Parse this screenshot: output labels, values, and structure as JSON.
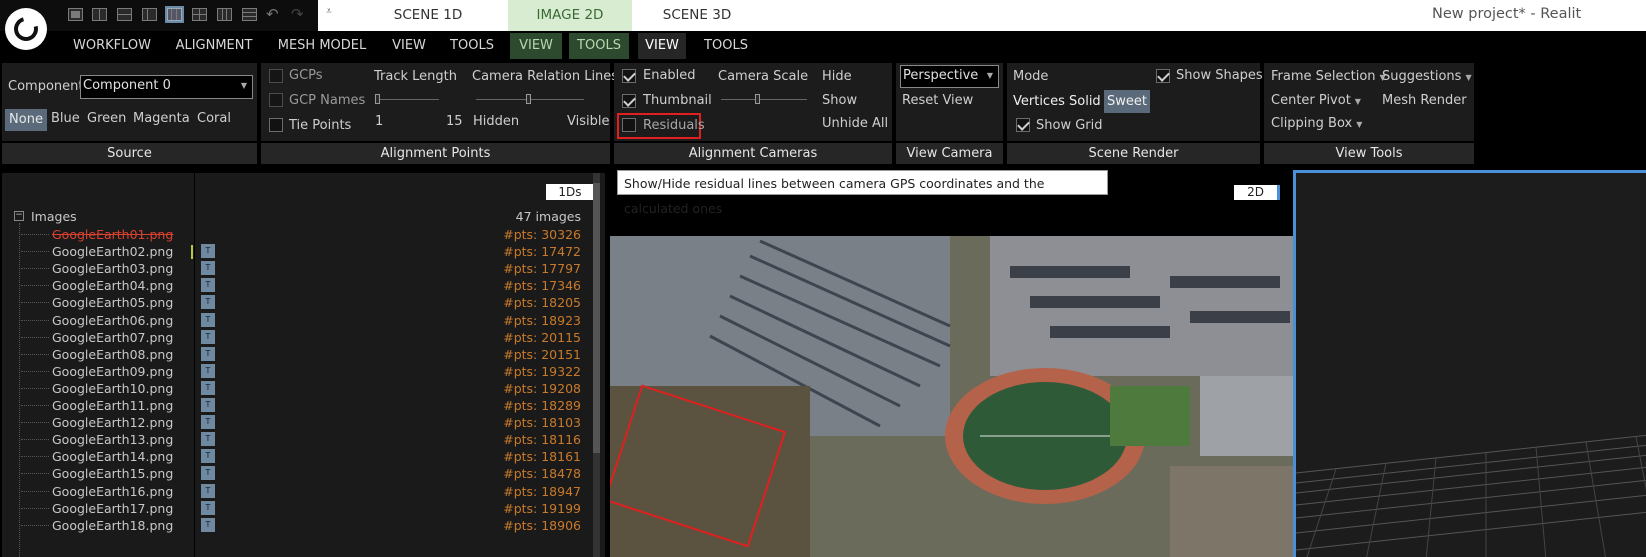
{
  "window": {
    "title": "New project* - Realit"
  },
  "scene_tabs": [
    "SCENE 1D",
    "IMAGE 2D",
    "SCENE 3D"
  ],
  "ribbon_tabs": [
    "WORKFLOW",
    "ALIGNMENT",
    "MESH MODEL",
    "VIEW",
    "TOOLS",
    "VIEW",
    "TOOLS",
    "VIEW",
    "TOOLS"
  ],
  "source": {
    "component_label": "Component",
    "component_value": "Component 0",
    "colors": [
      "None",
      "Blue",
      "Green",
      "Magenta",
      "Coral"
    ],
    "group_label": "Source"
  },
  "alignment_points": {
    "gcps": "GCPs",
    "gcp_names": "GCP Names",
    "tie_points": "Tie Points",
    "track_length": "Track Length",
    "track_min": "1",
    "track_max": "15",
    "camera_relation_lines": "Camera Relation Lines",
    "hidden": "Hidden",
    "visible": "Visible",
    "group_label": "Alignment Points"
  },
  "alignment_cameras": {
    "enabled": "Enabled",
    "thumbnail": "Thumbnail",
    "residuals": "Residuals",
    "camera_scale": "Camera Scale",
    "hide": "Hide",
    "show": "Show",
    "unhide_all": "Unhide All",
    "group_label": "Alignment Cameras"
  },
  "view_camera": {
    "projection": "Perspective",
    "reset_view": "Reset View",
    "group_label": "View Camera"
  },
  "scene_render": {
    "mode": "Mode",
    "show_shapes": "Show Shapes",
    "vertices": "Vertices",
    "solid": "Solid",
    "sweet": "Sweet",
    "show_grid": "Show Grid",
    "group_label": "Scene Render"
  },
  "view_tools": {
    "frame_selection": "Frame Selection",
    "suggestions": "Suggestions",
    "center_pivot": "Center Pivot",
    "mesh_render": "Mesh Render",
    "clipping_box": "Clipping Box",
    "group_label": "View Tools"
  },
  "tooltip": "Show/Hide residual lines between camera GPS coordinates and the calculated ones",
  "panes": {
    "one_ds": "1Ds",
    "two_d": "2D"
  },
  "tree": {
    "root": "Images",
    "count": "47 images",
    "images": [
      {
        "name": "GoogleEarth01.png",
        "pts": "#pts: 30326"
      },
      {
        "name": "GoogleEarth02.png",
        "pts": "#pts: 17472"
      },
      {
        "name": "GoogleEarth03.png",
        "pts": "#pts: 17797"
      },
      {
        "name": "GoogleEarth04.png",
        "pts": "#pts: 17346"
      },
      {
        "name": "GoogleEarth05.png",
        "pts": "#pts: 18205"
      },
      {
        "name": "GoogleEarth06.png",
        "pts": "#pts: 18923"
      },
      {
        "name": "GoogleEarth07.png",
        "pts": "#pts: 20115"
      },
      {
        "name": "GoogleEarth08.png",
        "pts": "#pts: 20151"
      },
      {
        "name": "GoogleEarth09.png",
        "pts": "#pts: 19322"
      },
      {
        "name": "GoogleEarth10.png",
        "pts": "#pts: 19208"
      },
      {
        "name": "GoogleEarth11.png",
        "pts": "#pts: 18289"
      },
      {
        "name": "GoogleEarth12.png",
        "pts": "#pts: 18103"
      },
      {
        "name": "GoogleEarth13.png",
        "pts": "#pts: 18116"
      },
      {
        "name": "GoogleEarth14.png",
        "pts": "#pts: 18161"
      },
      {
        "name": "GoogleEarth15.png",
        "pts": "#pts: 18478"
      },
      {
        "name": "GoogleEarth16.png",
        "pts": "#pts: 18947"
      },
      {
        "name": "GoogleEarth17.png",
        "pts": "#pts: 19199"
      },
      {
        "name": "GoogleEarth18.png",
        "pts": "#pts: 18906"
      }
    ]
  },
  "colors": {
    "accent_green": "#2e4a2e",
    "selected_blue": "#4a90d9",
    "pts_orange": "#c87a2a",
    "error_red": "#d9412f",
    "highlight_red": "#e0201e"
  }
}
